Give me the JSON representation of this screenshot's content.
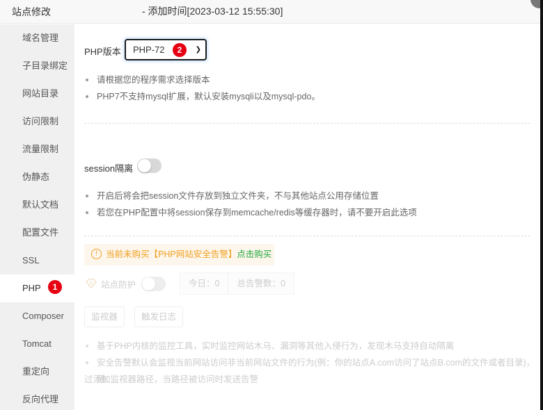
{
  "window": {
    "title": "站点修改",
    "subtitle": "- 添加时间[2023-03-12 15:55:30]"
  },
  "sidebar": {
    "items": [
      {
        "label": "域名管理"
      },
      {
        "label": "子目录绑定"
      },
      {
        "label": "网站目录"
      },
      {
        "label": "访问限制"
      },
      {
        "label": "流量限制"
      },
      {
        "label": "伪静态"
      },
      {
        "label": "默认文档"
      },
      {
        "label": "配置文件"
      },
      {
        "label": "SSL"
      },
      {
        "label": "PHP",
        "active": true,
        "badge": "1"
      },
      {
        "label": "Composer"
      },
      {
        "label": "Tomcat"
      },
      {
        "label": "重定向"
      },
      {
        "label": "反向代理"
      }
    ]
  },
  "php": {
    "version_label": "PHP版本",
    "version_value": "PHP-72",
    "select_badge": "2",
    "tips": [
      "请根据您的程序需求选择版本",
      "PHP7不支持mysql扩展，默认安装mysqli以及mysql-pdo。"
    ]
  },
  "session": {
    "label": "session隔离",
    "enabled": false,
    "tips": [
      "开启后将会把session文件存放到独立文件夹，不与其他站点公用存储位置",
      "若您在PHP配置中将session保存到memcache/redis等缓存器时，请不要开启此选项"
    ]
  },
  "security": {
    "warning_text": "当前未购买【PHP网站安全告警】",
    "warning_link": "点击购买",
    "warning_icon": "!",
    "protection_label": "站点防护",
    "protection_enabled": false,
    "today_label": "今日：0",
    "total_label": "总告警数：0",
    "monitor_button": "监视器",
    "log_button": "触发日志",
    "tips": [
      "基于PHP内核的监控工具，实时监控网站木马、漏洞等其他入侵行为，发现木马支持自动隔离",
      "安全告警默认会监视当前网站访问非当前网站文件的行为(例：你的站点A.com访问了站点B.com的文件或者目录)，通",
      "过添加监视器路径，当路径被访问时发送告警"
    ]
  },
  "colors": {
    "badge": "#e60012",
    "warning": "#f0a020",
    "link_green": "#20a53a"
  }
}
